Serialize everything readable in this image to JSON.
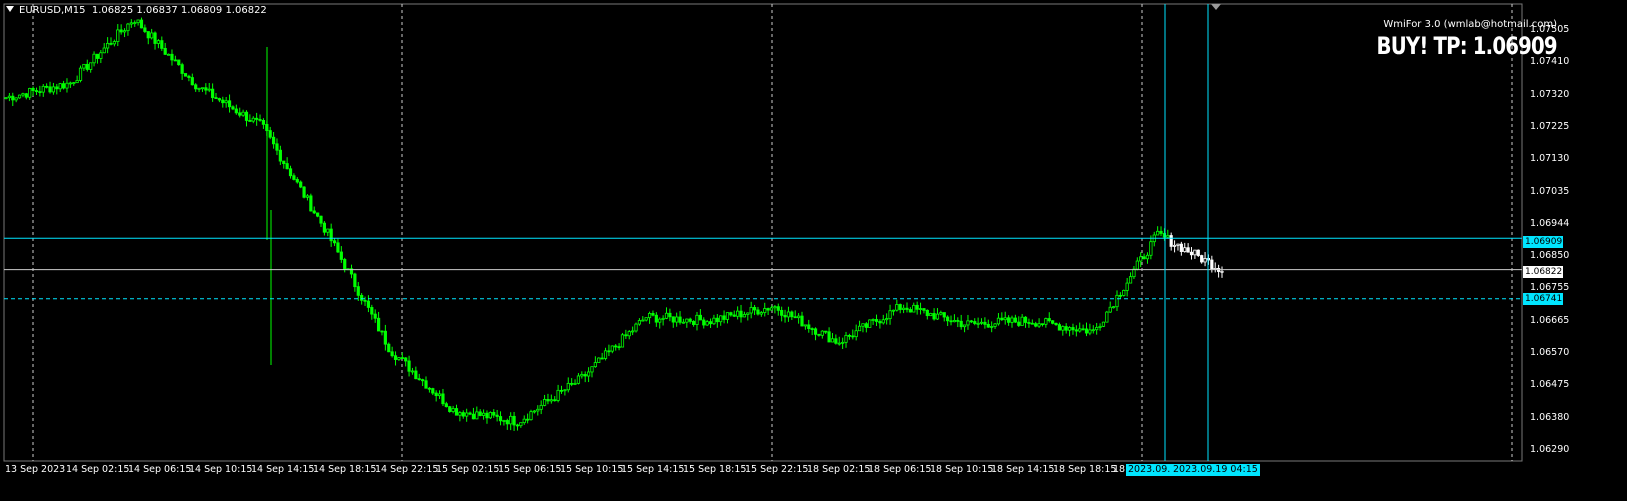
{
  "header": {
    "symbol": "EURUSD,M15",
    "ohlc": "1.06825 1.06837 1.06809 1.06822"
  },
  "indicator": {
    "credit": "WmiFor 3.0 (wmlab@hotmail.com)",
    "signal": "BUY!  TP: 1.06909"
  },
  "price_axis": {
    "labels": [
      "1.07505",
      "1.07410",
      "1.07320",
      "1.07225",
      "1.07130",
      "1.07035",
      "1.06944",
      "1.06850",
      "1.06755",
      "1.06665",
      "1.06570",
      "1.06475",
      "1.06380",
      "1.06290"
    ],
    "tag_tp": "1.06909",
    "tag_current": "1.06822",
    "tag_low": "1.06741"
  },
  "time_axis": {
    "labels": [
      "13 Sep 2023",
      "14 Sep 02:15",
      "14 Sep 06:15",
      "14 Sep 10:15",
      "14 Sep 14:15",
      "14 Sep 18:15",
      "14 Sep 22:15",
      "15 Sep 02:15",
      "15 Sep 06:15",
      "15 Sep 10:15",
      "15 Sep 14:15",
      "15 Sep 18:15",
      "15 Sep 22:15",
      "18 Sep 02:15",
      "18 Sep 06:15",
      "18 Sep 10:15",
      "18 Sep 14:15",
      "18 Sep 18:15",
      "18"
    ],
    "tag_a": "2023.09.1",
    "tag_b": "2023.09.19 04:15"
  },
  "colors": {
    "background": "#000000",
    "candles": "#00ff00",
    "recent_candles": "#ffffff",
    "level_lines": "#00e5ff",
    "grid": "#ffffff"
  },
  "chart_data": {
    "type": "candlestick",
    "symbol": "EURUSD",
    "timeframe": "M15",
    "ylim": [
      1.0629,
      1.0756
    ],
    "levels": {
      "tp": 1.06909,
      "current": 1.06822,
      "low": 1.06741
    },
    "anchors": [
      {
        "t": "13 Sep 2023",
        "close": 1.073
      },
      {
        "t": "14 Sep 02:15",
        "close": 1.0734
      },
      {
        "t": "14 Sep 06:15",
        "close": 1.0752
      },
      {
        "t": "14 Sep 10:15",
        "close": 1.0733
      },
      {
        "t": "14 Sep 14:15",
        "close": 1.0722
      },
      {
        "t": "14 Sep 16:15",
        "close": 1.0693
      },
      {
        "t": "14 Sep 18:15",
        "close": 1.066
      },
      {
        "t": "14 Sep 22:15",
        "close": 1.0643
      },
      {
        "t": "15 Sep 02:15",
        "close": 1.064
      },
      {
        "t": "15 Sep 06:15",
        "close": 1.0652
      },
      {
        "t": "15 Sep 10:15",
        "close": 1.0669
      },
      {
        "t": "15 Sep 14:15",
        "close": 1.0668
      },
      {
        "t": "15 Sep 18:15",
        "close": 1.0672
      },
      {
        "t": "15 Sep 22:15",
        "close": 1.0662
      },
      {
        "t": "18 Sep 02:15",
        "close": 1.0672
      },
      {
        "t": "18 Sep 06:15",
        "close": 1.0667
      },
      {
        "t": "18 Sep 10:15",
        "close": 1.0668
      },
      {
        "t": "18 Sep 14:15",
        "close": 1.0665
      },
      {
        "t": "18 Sep 18:15",
        "close": 1.0692
      },
      {
        "t": "19 Sep 04:15",
        "close": 1.06822
      }
    ]
  }
}
